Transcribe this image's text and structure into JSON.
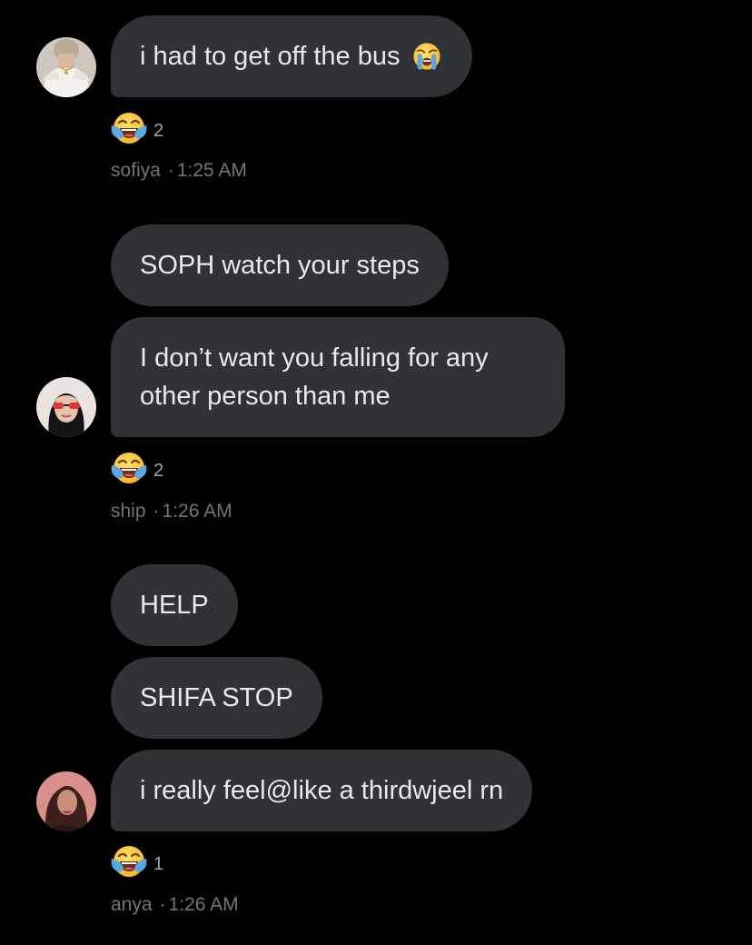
{
  "colors": {
    "background": "#000000",
    "bubble": "#2f3336",
    "text": "#e7e9ea",
    "meta_text": "#71767b"
  },
  "groups": [
    {
      "messages": [
        {
          "text": "i had to get off the bus",
          "emoji": "loudly-crying-face-icon"
        }
      ],
      "reaction": {
        "emoji": "face-with-tears-of-joy-icon",
        "count": "2"
      },
      "sender": "sofiya",
      "separator": "·",
      "time": "1:25 AM"
    },
    {
      "messages": [
        {
          "text": "SOPH watch your steps"
        },
        {
          "text": "I don’t want you falling for any other person than me"
        }
      ],
      "reaction": {
        "emoji": "face-with-tears-of-joy-icon",
        "count": "2"
      },
      "sender": "ship",
      "separator": "·",
      "time": "1:26 AM"
    },
    {
      "messages": [
        {
          "text": "HELP"
        },
        {
          "text": "SHIFA STOP"
        },
        {
          "text": "i really feel@like a thirdwjeel rn"
        }
      ],
      "reaction": {
        "emoji": "face-with-tears-of-joy-icon",
        "count": "1"
      },
      "sender": "anya",
      "separator": "·",
      "time": "1:26 AM"
    }
  ]
}
